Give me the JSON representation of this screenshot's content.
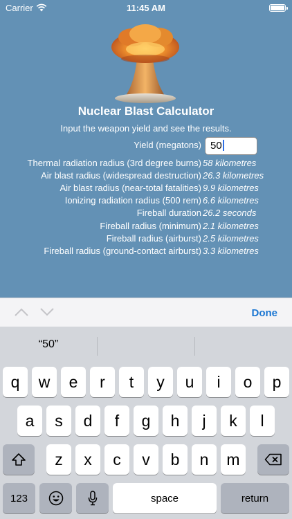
{
  "status_bar": {
    "carrier": "Carrier",
    "time": "11:45 AM"
  },
  "app": {
    "title": "Nuclear Blast Calculator",
    "instructions": "Input the weapon yield and see the results.",
    "yield_label": "Yield (megatons)",
    "yield_value": "50"
  },
  "results": [
    {
      "label": "Thermal radiation radius (3rd degree burns)",
      "value": "58 kilometres"
    },
    {
      "label": "Air blast radius (widespread destruction)",
      "value": "26.3 kilometres"
    },
    {
      "label": "Air blast radius (near-total fatalities)",
      "value": "9.9 kilometres"
    },
    {
      "label": "Ionizing radiation radius (500 rem)",
      "value": "6.6 kilometres"
    },
    {
      "label": "Fireball duration",
      "value": "26.2 seconds"
    },
    {
      "label": "Fireball radius (minimum)",
      "value": "2.1 kilometres"
    },
    {
      "label": "Fireball radius (airburst)",
      "value": "2.5 kilometres"
    },
    {
      "label": "Fireball radius (ground-contact airburst)",
      "value": "3.3 kilometres"
    }
  ],
  "accessory": {
    "prev_icon": "chevron-up-icon",
    "next_icon": "chevron-down-icon",
    "done_label": "Done"
  },
  "keyboard": {
    "suggestion": "“50”",
    "row1": [
      "q",
      "w",
      "e",
      "r",
      "t",
      "y",
      "u",
      "i",
      "o",
      "p"
    ],
    "row2": [
      "a",
      "s",
      "d",
      "f",
      "g",
      "h",
      "j",
      "k",
      "l"
    ],
    "row3": [
      "z",
      "x",
      "c",
      "v",
      "b",
      "n",
      "m"
    ],
    "shift_icon": "shift-icon",
    "delete_icon": "backspace-icon",
    "numbers_label": "123",
    "emoji_icon": "emoji-icon",
    "mic_icon": "microphone-icon",
    "space_label": "space",
    "return_label": "return"
  },
  "colors": {
    "background": "#6391b5",
    "accent": "#1a76d2"
  }
}
